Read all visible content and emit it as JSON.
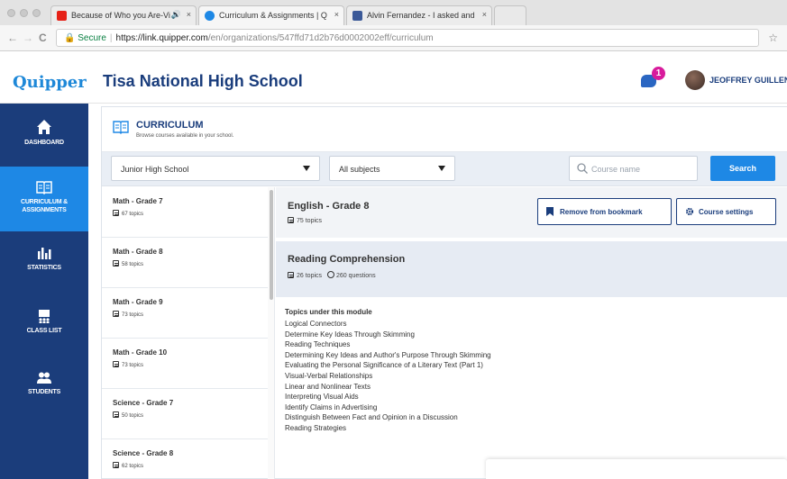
{
  "browser": {
    "tabs": [
      {
        "title": "Because of Who you Are-Vi",
        "favicon_color": "#e62117"
      },
      {
        "title": "Curriculum & Assignments | Q",
        "favicon_color": "#1e88e5"
      },
      {
        "title": "Alvin Fernandez - I asked and",
        "favicon_color": "#3b5998"
      }
    ],
    "tab_close": "×",
    "audio_icon": "🔊",
    "nav_back": "←",
    "nav_forward": "→",
    "nav_reload": "C",
    "secure_label": "Secure",
    "url_host": "https://link.quipper.com",
    "url_path": "/en/organizations/547ffd71d2b76d0002002eff/curriculum",
    "bookmark_star": "☆"
  },
  "header": {
    "logo": "Quipper",
    "school_name": "Tisa National High School",
    "notification_count": "1",
    "user_name": "JEOFFREY GUILLEN ▾"
  },
  "sidebar": {
    "items": [
      {
        "label_line1": "DASHBOARD",
        "label_line2": ""
      },
      {
        "label_line1": "CURRICULUM &",
        "label_line2": "ASSIGNMENTS"
      },
      {
        "label_line1": "STATISTICS",
        "label_line2": ""
      },
      {
        "label_line1": "CLASS LIST",
        "label_line2": ""
      },
      {
        "label_line1": "STUDENTS",
        "label_line2": ""
      }
    ]
  },
  "curriculum": {
    "title": "CURRICULUM",
    "subtitle": "Browse courses available in your school."
  },
  "filters": {
    "level": "Junior High School",
    "subject": "All subjects",
    "search_placeholder": "Course name",
    "search_button": "Search"
  },
  "courses": [
    {
      "name": "Math - Grade 7",
      "topics": "67 topics"
    },
    {
      "name": "Math - Grade 8",
      "topics": "58 topics"
    },
    {
      "name": "Math - Grade 9",
      "topics": "73 topics"
    },
    {
      "name": "Math - Grade 10",
      "topics": "73 topics"
    },
    {
      "name": "Science - Grade 7",
      "topics": "50 topics"
    },
    {
      "name": "Science - Grade 8",
      "topics": "62 topics"
    }
  ],
  "selected_course": {
    "name": "English - Grade 8",
    "topics": "75 topics",
    "bookmark_button": "Remove from bookmark",
    "settings_button": "Course settings"
  },
  "module": {
    "name": "Reading Comprehension",
    "topics": "26 topics",
    "questions": "260 questions",
    "topics_heading": "Topics under this module",
    "topic_list": [
      "Logical Connectors",
      "Determine Key Ideas Through Skimming",
      "Reading Techniques",
      "Determining Key Ideas and Author's Purpose Through Skimming",
      "Evaluating the Personal Significance of a Literary Text (Part 1)",
      "Visual-Verbal Relationships",
      "Linear and Nonlinear Texts",
      "Interpreting Visual Aids",
      "Identify Claims in Advertising",
      "Distinguish Between Fact and Opinion in a Discussion",
      "Reading Strategies"
    ]
  },
  "colors": {
    "sidebar_bg": "#1b3d7b",
    "sidebar_active": "#1e88e5",
    "brand_blue": "#1e88d8",
    "title_navy": "#1a3d7c",
    "badge_pink": "#d81b9c"
  }
}
